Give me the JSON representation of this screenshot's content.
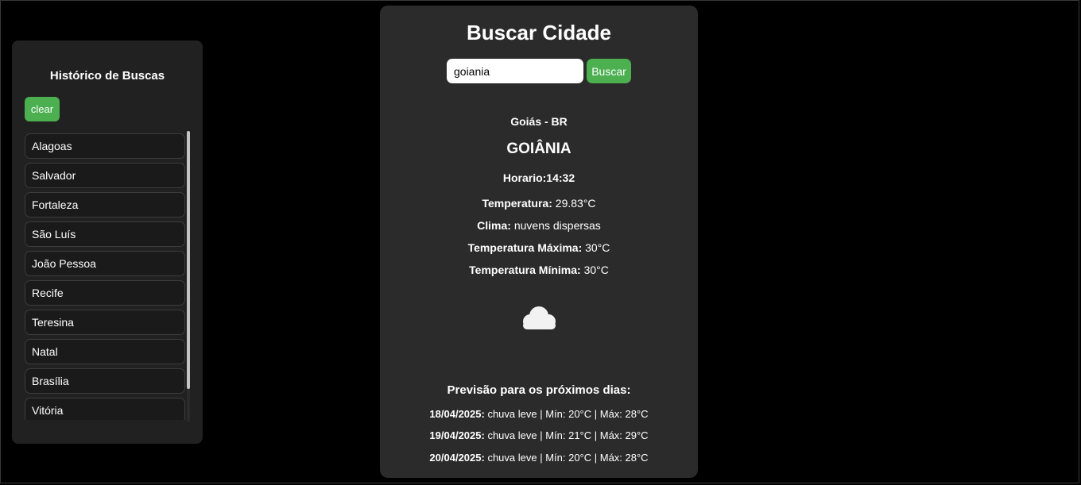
{
  "sidebar": {
    "title": "Histórico de Buscas",
    "clear_label": "clear",
    "items": [
      "Alagoas",
      "Salvador",
      "Fortaleza",
      "São Luís",
      "João Pessoa",
      "Recife",
      "Teresina",
      "Natal",
      "Brasília",
      "Vitória"
    ]
  },
  "main": {
    "title": "Buscar Cidade",
    "search": {
      "value": "goiania",
      "button_label": "Buscar"
    },
    "location": "Goiás - BR",
    "city": "GOIÂNIA",
    "time": "Horario:14:32",
    "details": [
      {
        "label": "Temperatura:",
        "value": "29.83°C"
      },
      {
        "label": "Clima:",
        "value": "nuvens dispersas"
      },
      {
        "label": "Temperatura Máxima:",
        "value": "30°C"
      },
      {
        "label": "Temperatura Mínima:",
        "value": "30°C"
      }
    ],
    "weather_icon": "cloud-icon",
    "forecast": {
      "title": "Previsão para os próximos dias:",
      "days": [
        {
          "date": "18/04/2025:",
          "text": "chuva leve | Mín: 20°C | Máx: 28°C"
        },
        {
          "date": "19/04/2025:",
          "text": "chuva leve | Mín: 21°C | Máx: 29°C"
        },
        {
          "date": "20/04/2025:",
          "text": "chuva leve | Mín: 20°C | Máx: 28°C"
        }
      ]
    }
  },
  "colors": {
    "background": "#000000",
    "panel": "#2b2b2b",
    "sidebar": "#212121",
    "accent": "#4caf50"
  }
}
